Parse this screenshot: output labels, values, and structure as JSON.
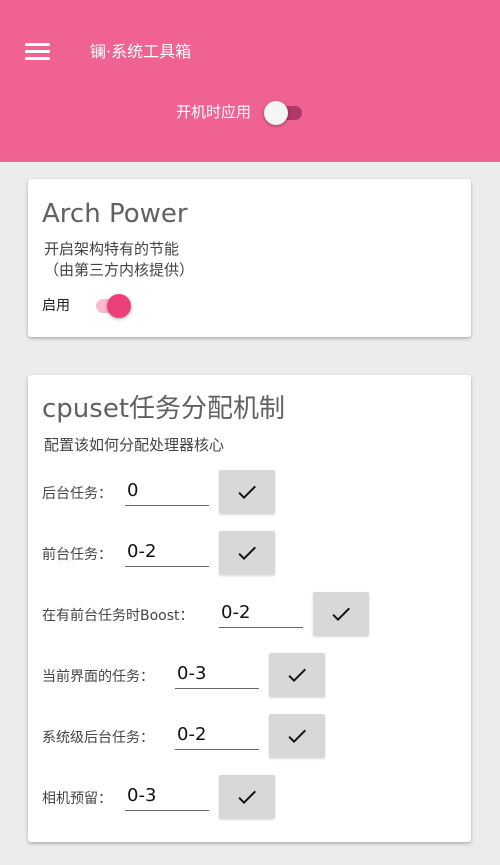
{
  "app": {
    "title": "镧·系统工具箱"
  },
  "header": {
    "boot_label": "开机时应用",
    "boot_enabled": false
  },
  "arch_card": {
    "title": "Arch Power",
    "desc_line1": "开启架构特有的节能",
    "desc_line2": "（由第三方内核提供）",
    "enable_label": "启用",
    "enabled": true
  },
  "cpuset_card": {
    "title": "cpuset任务分配机制",
    "desc": "配置该如何分配处理器核心",
    "rows": [
      {
        "label": "后台任务：",
        "value": "0",
        "button_icon": "check-icon"
      },
      {
        "label": "前台任务：",
        "value": "0-2",
        "button_icon": "check-icon"
      },
      {
        "label": "在有前台任务时Boost：",
        "value": "0-2",
        "button_icon": "check-icon"
      },
      {
        "label": "当前界面的任务：",
        "value": "0-3",
        "button_icon": "check-icon"
      },
      {
        "label": "系统级后台任务：",
        "value": "0-2",
        "button_icon": "check-icon"
      },
      {
        "label": "相机预留：",
        "value": "0-3",
        "button_icon": "check-icon"
      }
    ]
  },
  "colors": {
    "accent": "#f06292",
    "switch_on": "#ec407a",
    "background": "#ececec"
  }
}
